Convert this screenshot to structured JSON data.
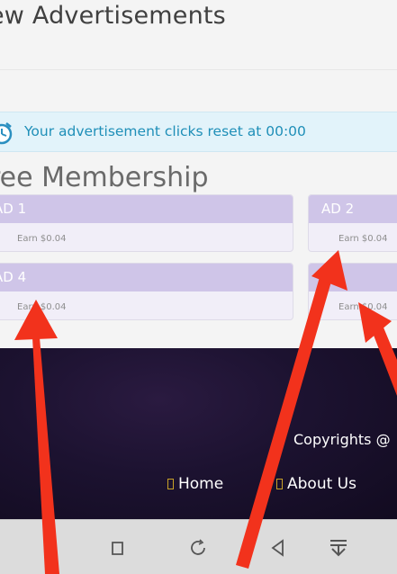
{
  "header": {
    "title": "ew Advertisements"
  },
  "notice": {
    "text": "Your advertisement clicks reset at 00:00"
  },
  "section": {
    "title": "ree Membership"
  },
  "ads": [
    {
      "name": "AD 1",
      "earn": "Earn $0.04"
    },
    {
      "name": "AD 2",
      "earn": "Earn $0.04"
    },
    {
      "name": "AD 4",
      "earn": "Earn $0.04"
    },
    {
      "name": "",
      "earn": "Earn $0.04"
    }
  ],
  "footer": {
    "copyright": "Copyrights @",
    "links": [
      {
        "label": "Home"
      },
      {
        "label": "About Us"
      }
    ]
  },
  "colors": {
    "arrow": "#f2321c",
    "notice_text": "#1f8fb8",
    "ad_header": "#cfc5e8"
  }
}
